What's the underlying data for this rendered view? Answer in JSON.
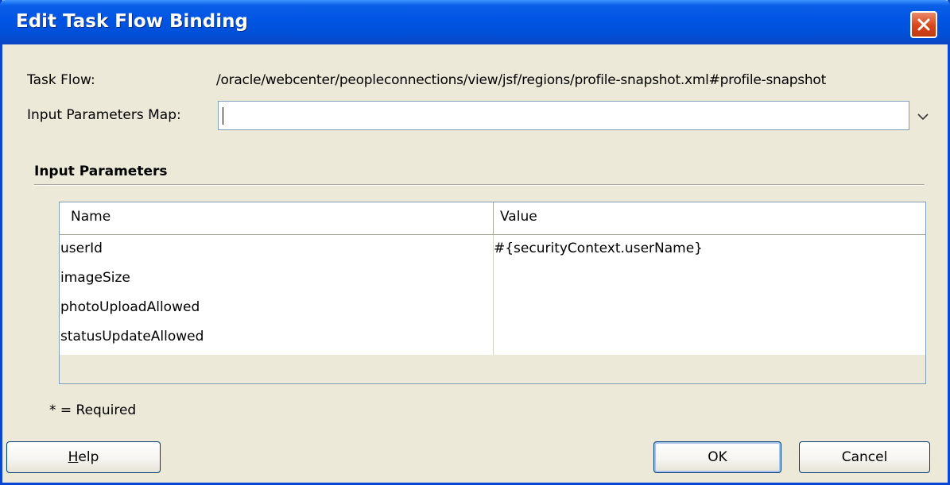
{
  "window": {
    "title": "Edit Task Flow Binding",
    "close_icon": "close-icon",
    "accent_color": "#0054e3",
    "background_color": "#ece9d8"
  },
  "form": {
    "task_flow_label": "Task Flow:",
    "task_flow_value": "/oracle/webcenter/peopleconnections/view/jsf/regions/profile-snapshot.xml#profile-snapshot",
    "input_map_label": "Input Parameters Map:",
    "input_map_value": "",
    "dropdown_icon": "chevron-down-icon"
  },
  "parameters": {
    "section_title": "Input Parameters",
    "columns": [
      "Name",
      "Value"
    ],
    "rows": [
      {
        "name": "userId",
        "value": "#{securityContext.userName}"
      },
      {
        "name": "imageSize",
        "value": ""
      },
      {
        "name": "photoUploadAllowed",
        "value": ""
      },
      {
        "name": "statusUpdateAllowed",
        "value": ""
      }
    ]
  },
  "footer": {
    "required_note": "* = Required",
    "help_label_mnemonic": "H",
    "help_label_rest": "elp",
    "ok_label": "OK",
    "cancel_label": "Cancel"
  }
}
